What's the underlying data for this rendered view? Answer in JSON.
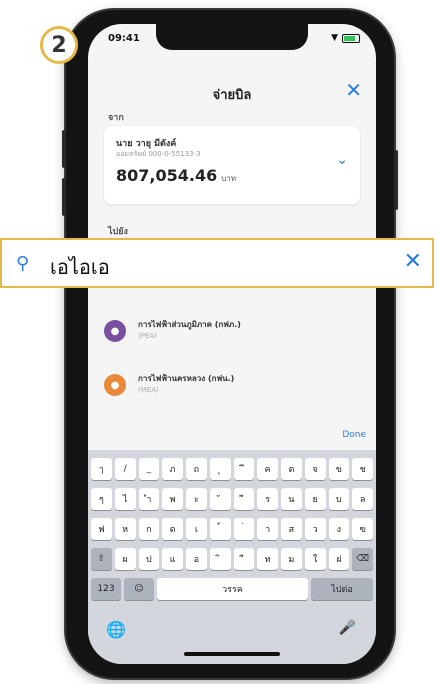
{
  "step_number": "2",
  "status": {
    "time": "09:41"
  },
  "header": {
    "title": "จ่ายบิล"
  },
  "from": {
    "label": "จาก",
    "account_name": "นาย วายุ มีตังค์",
    "account_number": "ออมทรัพย์ 000-0-55133-3",
    "balance": "807,054.46",
    "currency": "บาท"
  },
  "to": {
    "label": "ไปยัง"
  },
  "search": {
    "query": "เอไอเอ"
  },
  "billers": [
    {
      "name": "การไฟฟ้าส่วนภูมิภาค (กฟภ.)",
      "code": "(PEA)"
    },
    {
      "name": "การไฟฟ้านครหลวง (กฟน.)",
      "code": "(MEA)"
    }
  ],
  "keyboard": {
    "done_label": "Done",
    "rows": [
      [
        "ๅ",
        "/",
        "_",
        "ภ",
        "ถ",
        "ุ",
        "ึ",
        "ค",
        "ต",
        "จ",
        "ข",
        "ช"
      ],
      [
        "ๆ",
        "ไ",
        "ำ",
        "พ",
        "ะ",
        "ั",
        "ี",
        "ร",
        "น",
        "ย",
        "บ",
        "ล"
      ],
      [
        "ฟ",
        "ห",
        "ก",
        "ด",
        "เ",
        "้",
        "่",
        "า",
        "ส",
        "ว",
        "ง",
        "ฃ"
      ],
      [
        "⇧",
        "ผ",
        "ป",
        "แ",
        "อ",
        "ิ",
        "ื",
        "ท",
        "ม",
        "ใ",
        "ฝ",
        "⌫"
      ]
    ],
    "bottom": {
      "numbers_label": "123",
      "space_label": "วรรค",
      "return_label": "ไปต่อ"
    }
  }
}
